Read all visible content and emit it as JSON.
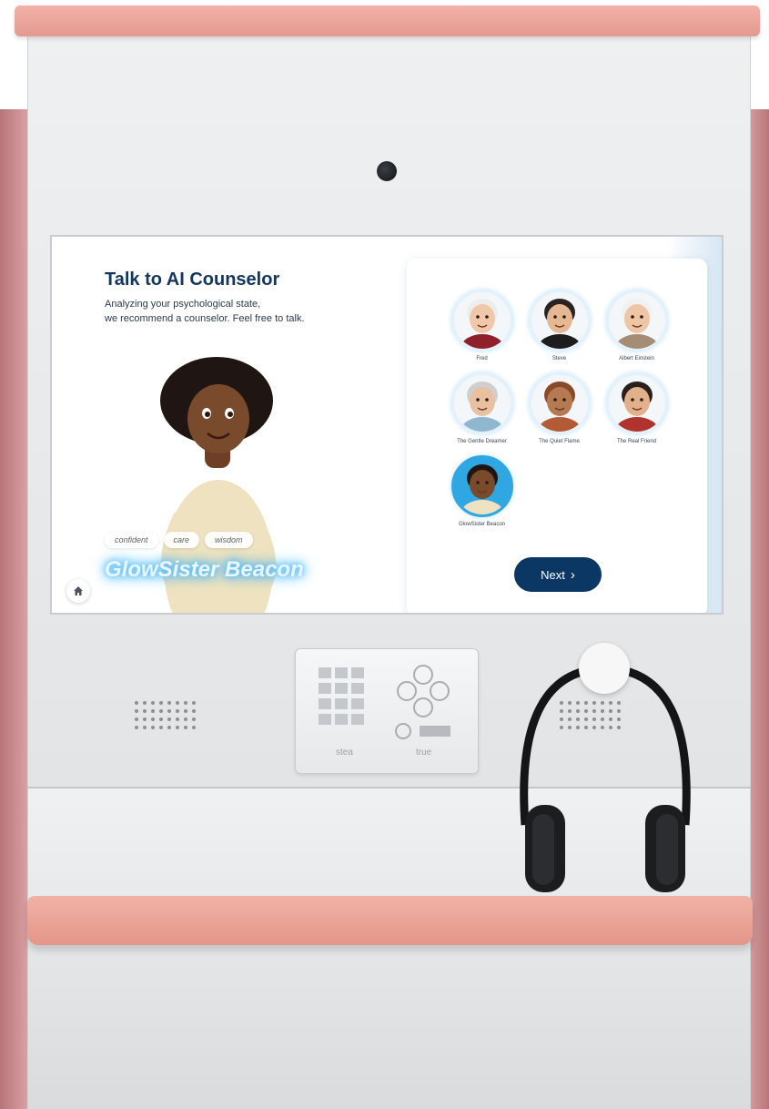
{
  "app": {
    "title": "Talk to AI Counselor",
    "subtitle": "Analyzing your psychological state,\nwe recommend a counselor. Feel free to talk."
  },
  "featured": {
    "name": "GlowSister Beacon",
    "tags": [
      "confident",
      "care",
      "wisdom"
    ]
  },
  "counselors": [
    {
      "name": "Fred",
      "skin": "#f1c7a9",
      "hair": "#ededed",
      "shirt": "#8f1f2a"
    },
    {
      "name": "Steve",
      "skin": "#e5b792",
      "hair": "#2a2320",
      "shirt": "#1d1d1f"
    },
    {
      "name": "Albert Einstein",
      "skin": "#eec6a6",
      "hair": "#f1f1f1",
      "shirt": "#a58c75"
    },
    {
      "name": "The Gentle Dreamer",
      "skin": "#e9c1a1",
      "hair": "#cfcfcf",
      "shirt": "#8fb7cf"
    },
    {
      "name": "The Quiet Flame",
      "skin": "#b57a52",
      "hair": "#8a4a2a",
      "shirt": "#b35a36"
    },
    {
      "name": "The Real Friend",
      "skin": "#e3b08c",
      "hair": "#2b1f1a",
      "shirt": "#b2332d"
    },
    {
      "name": "GlowSister Beacon",
      "skin": "#7a4a2c",
      "hair": "#1f1613",
      "shirt": "#efe2c0",
      "selected": true
    }
  ],
  "buttons": {
    "next": "Next",
    "next_icon": "chevron-right-icon",
    "home_icon": "home-icon"
  },
  "keypad": {
    "left_label": "stea",
    "right_label": "true"
  },
  "colors": {
    "accent": "#0b3765",
    "glow": "#2aa2ee",
    "kiosk_trim": "#e8a095"
  }
}
